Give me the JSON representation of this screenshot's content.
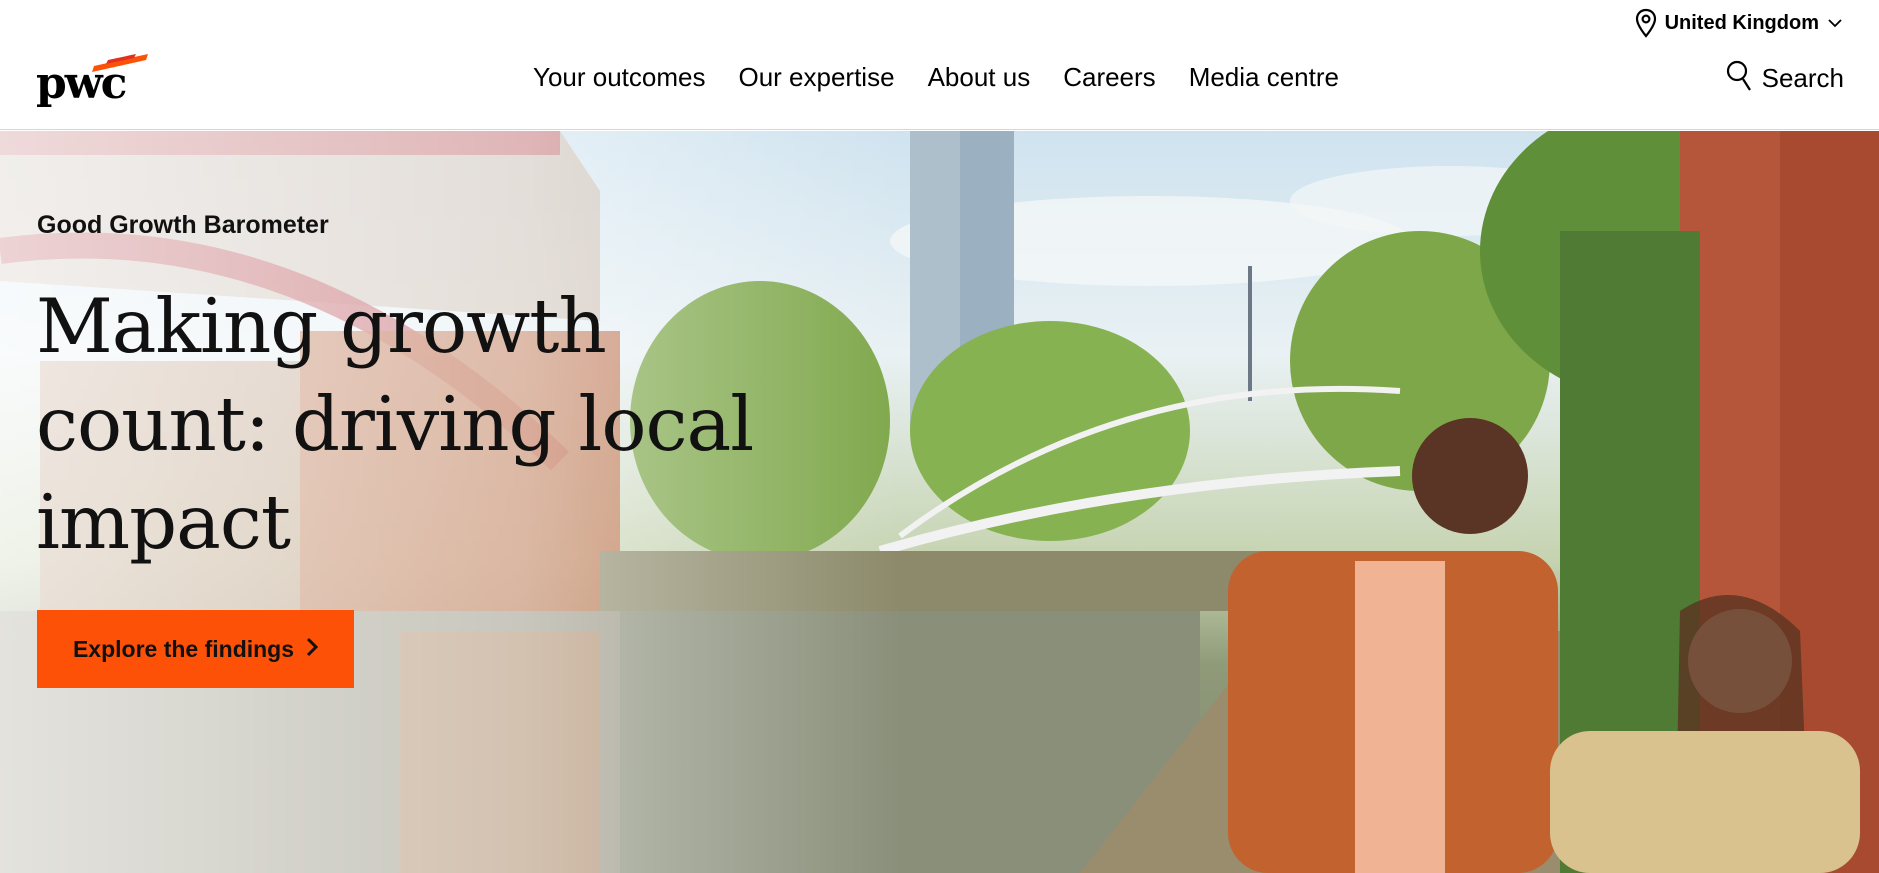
{
  "utility": {
    "country_label": "United Kingdom",
    "pin_icon": "location-pin-icon",
    "chevron_icon": "chevron-down-icon"
  },
  "header": {
    "logo_text": "pwc",
    "nav": [
      {
        "label": "Your outcomes"
      },
      {
        "label": "Our expertise"
      },
      {
        "label": "About us"
      },
      {
        "label": "Careers"
      },
      {
        "label": "Media centre"
      }
    ],
    "search_label": "Search",
    "search_icon": "search-icon"
  },
  "hero": {
    "eyebrow": "Good Growth Barometer",
    "headline": "Making growth count: driving local impact",
    "cta_label": "Explore the findings",
    "cta_icon": "chevron-right-icon"
  },
  "colors": {
    "brand_orange": "#fd5108",
    "logo_accent": "#e0301e",
    "text": "#000000"
  }
}
